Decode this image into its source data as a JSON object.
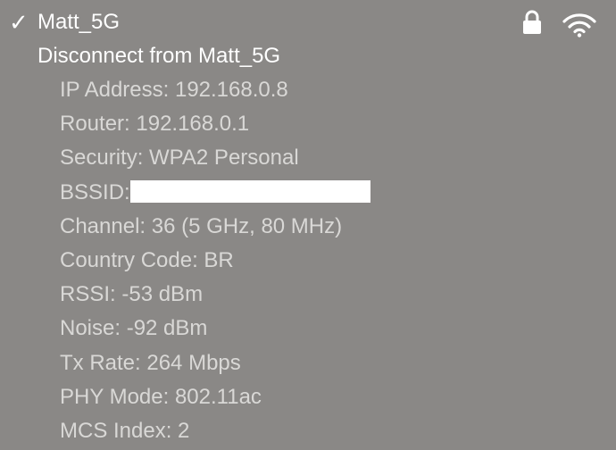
{
  "network": {
    "check_glyph": "✓",
    "name": "Matt_5G",
    "icons": [
      "lock-icon",
      "wifi-icon"
    ]
  },
  "actions": {
    "disconnect_label": "Disconnect from Matt_5G"
  },
  "details": [
    {
      "key": "ip",
      "label": "IP Address: 192.168.0.8"
    },
    {
      "key": "router",
      "label": "Router: 192.168.0.1"
    },
    {
      "key": "security",
      "label": "Security: WPA2 Personal"
    },
    {
      "key": "bssid",
      "label": "BSSID:",
      "redacted": true
    },
    {
      "key": "channel",
      "label": "Channel: 36 (5 GHz, 80 MHz)"
    },
    {
      "key": "country",
      "label": "Country Code: BR"
    },
    {
      "key": "rssi",
      "label": "RSSI: -53 dBm"
    },
    {
      "key": "noise",
      "label": "Noise: -92 dBm"
    },
    {
      "key": "tx",
      "label": "Tx Rate: 264 Mbps"
    },
    {
      "key": "phy",
      "label": "PHY Mode: 802.11ac"
    },
    {
      "key": "mcs",
      "label": "MCS Index: 2"
    }
  ],
  "colors": {
    "background": "#8a8886",
    "primary_text": "#ffffff",
    "detail_text": "#d9d8d6",
    "redaction": "#ffffff"
  }
}
